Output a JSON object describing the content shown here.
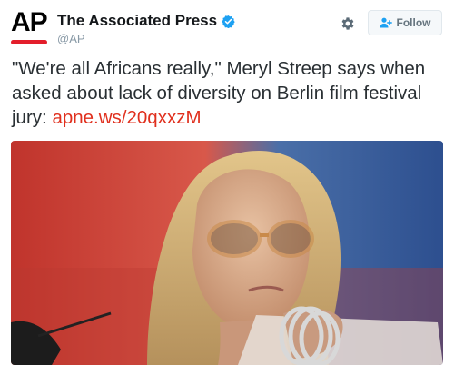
{
  "account": {
    "avatar_text": "AP",
    "display_name": "The Associated Press",
    "handle": "@AP",
    "verified": true
  },
  "actions": {
    "settings_icon": "gear-icon",
    "follow_label": "Follow"
  },
  "tweet": {
    "text": "\"We're all Africans really,\" Meryl Streep says when asked about lack of diversity on Berlin film festival jury: ",
    "link": "apne.ws/20qxxzM"
  },
  "photo": {
    "icon": "photo-of-woman-with-glasses"
  },
  "colors": {
    "brand_red": "#e31e2b",
    "link": "#e0301e",
    "verified": "#1da1f2",
    "text": "#292f33",
    "muted": "#8899a6"
  }
}
